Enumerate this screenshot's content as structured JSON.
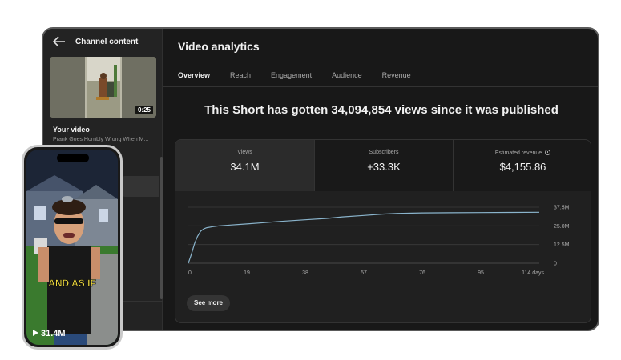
{
  "sidebar": {
    "title": "Channel content",
    "thumbnail_duration": "0:25",
    "your_video_label": "Your video",
    "video_title": "Prank Goes Horribly Wrong When M..."
  },
  "main": {
    "title": "Video analytics",
    "tabs": [
      {
        "label": "Overview",
        "active": true
      },
      {
        "label": "Reach",
        "active": false
      },
      {
        "label": "Engagement",
        "active": false
      },
      {
        "label": "Audience",
        "active": false
      },
      {
        "label": "Revenue",
        "active": false
      }
    ],
    "headline": "This Short has gotten 34,094,854 views since it was published"
  },
  "metrics": {
    "views": {
      "label": "Views",
      "value": "34.1M"
    },
    "subscribers": {
      "label": "Subscribers",
      "value": "+33.3K"
    },
    "revenue": {
      "label": "Estimated revenue",
      "value": "$4,155.86",
      "icon": "clock-icon"
    }
  },
  "see_more_label": "See more",
  "phone": {
    "caption": "AND AS IF",
    "views": "31.4M",
    "icon": "play-icon"
  },
  "colors": {
    "line": "#8ab4cc",
    "background": "#181818",
    "card": "#202020"
  },
  "chart_data": {
    "type": "line",
    "x_tick_labels": [
      "0",
      "19",
      "38",
      "57",
      "76",
      "95",
      "114 days"
    ],
    "y_tick_labels": [
      "0",
      "12.5M",
      "25.0M",
      "37.5M"
    ],
    "ylim": [
      0,
      37500000
    ],
    "xlim": [
      0,
      114
    ],
    "grid": true,
    "series": [
      {
        "x": [
          0,
          1,
          2,
          3,
          4,
          5,
          6,
          8,
          10,
          14,
          19,
          25,
          30,
          38,
          45,
          50,
          57,
          63,
          68,
          76,
          85,
          95,
          105,
          114
        ],
        "y": [
          0,
          6000000,
          13000000,
          18000000,
          21500000,
          23000000,
          23800000,
          24500000,
          25000000,
          25600000,
          26300000,
          27200000,
          28000000,
          29100000,
          30000000,
          31000000,
          32000000,
          32900000,
          33400000,
          33700000,
          33800000,
          33900000,
          34000000,
          34100000
        ]
      }
    ]
  }
}
